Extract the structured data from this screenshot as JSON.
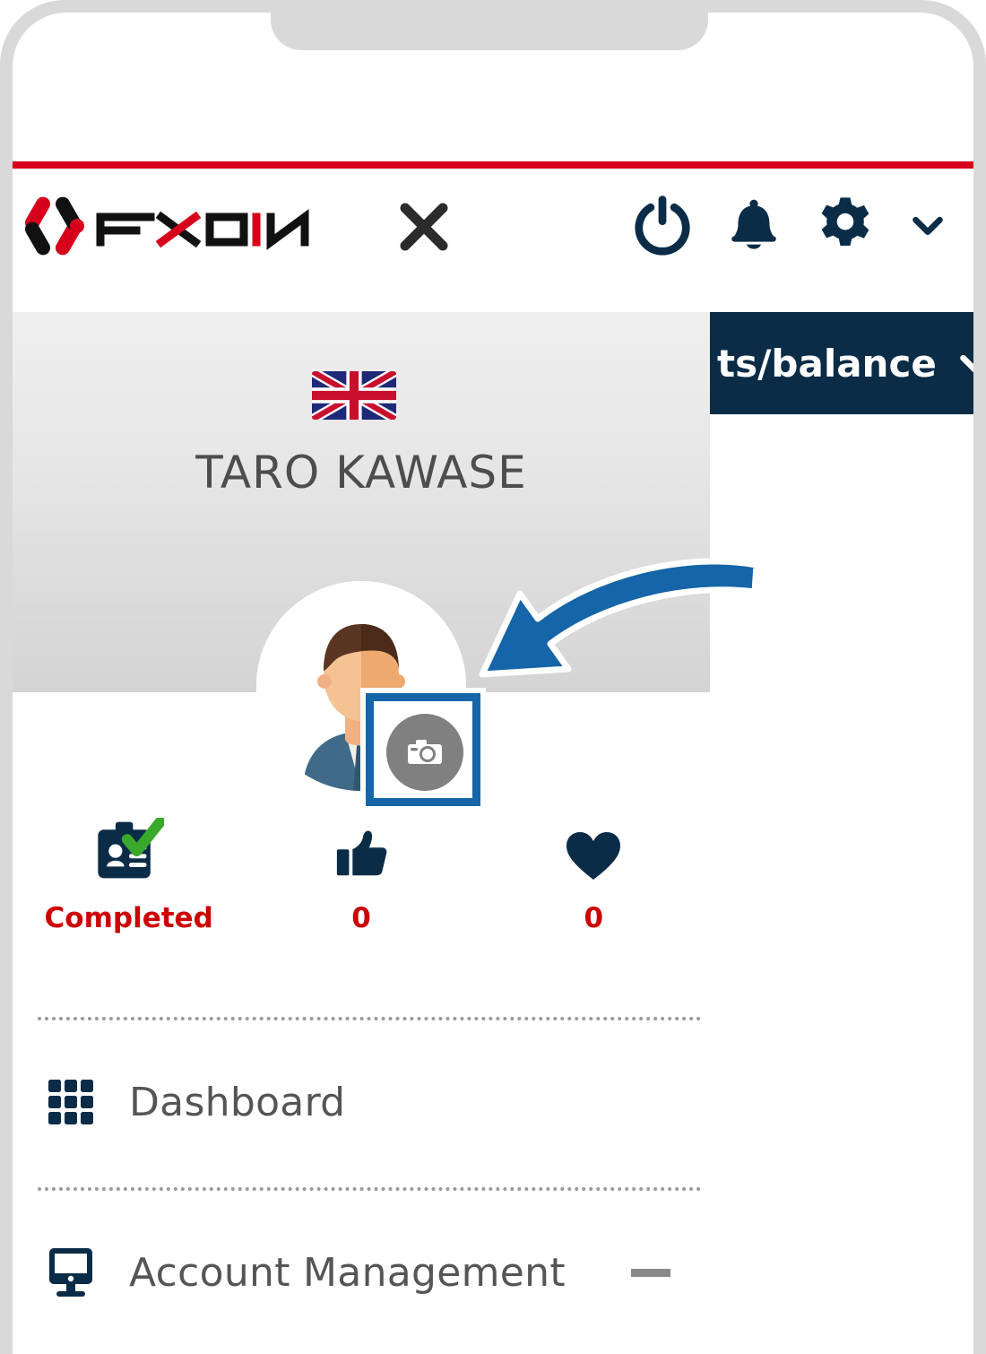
{
  "app": {
    "brand_name": "FXON",
    "accent_red": "#d6001c",
    "navy": "#0b2c47",
    "highlight_blue": "#1565a8"
  },
  "header": {
    "logo_text": "FXON",
    "close_icon": "close-x-icon",
    "actions": [
      {
        "name": "power-icon",
        "label": "Logout"
      },
      {
        "name": "bell-icon",
        "label": "Notifications"
      },
      {
        "name": "gear-icon",
        "label": "Settings"
      },
      {
        "name": "chevron-down-icon",
        "label": "More"
      }
    ]
  },
  "balance_bar": {
    "label": "ts/balance",
    "caret_icon": "chevron-down-icon"
  },
  "profile": {
    "flag_icon": "uk-flag-icon",
    "flag_country": "United Kingdom",
    "name": "TARO KAWASE",
    "avatar_icon": "user-avatar",
    "camera_button_icon": "camera-icon"
  },
  "stats": [
    {
      "icon": "id-card-check-icon",
      "label": "Completed"
    },
    {
      "icon": "thumbs-up-icon",
      "label": "0"
    },
    {
      "icon": "heart-icon",
      "label": "0"
    }
  ],
  "menu": [
    {
      "icon": "grid-icon",
      "label": "Dashboard",
      "toggle": false
    },
    {
      "icon": "monitor-icon",
      "label": "Account Management",
      "toggle": true
    }
  ],
  "annotation": {
    "arrow_icon": "curved-arrow-icon",
    "arrow_color": "#1565a8"
  }
}
